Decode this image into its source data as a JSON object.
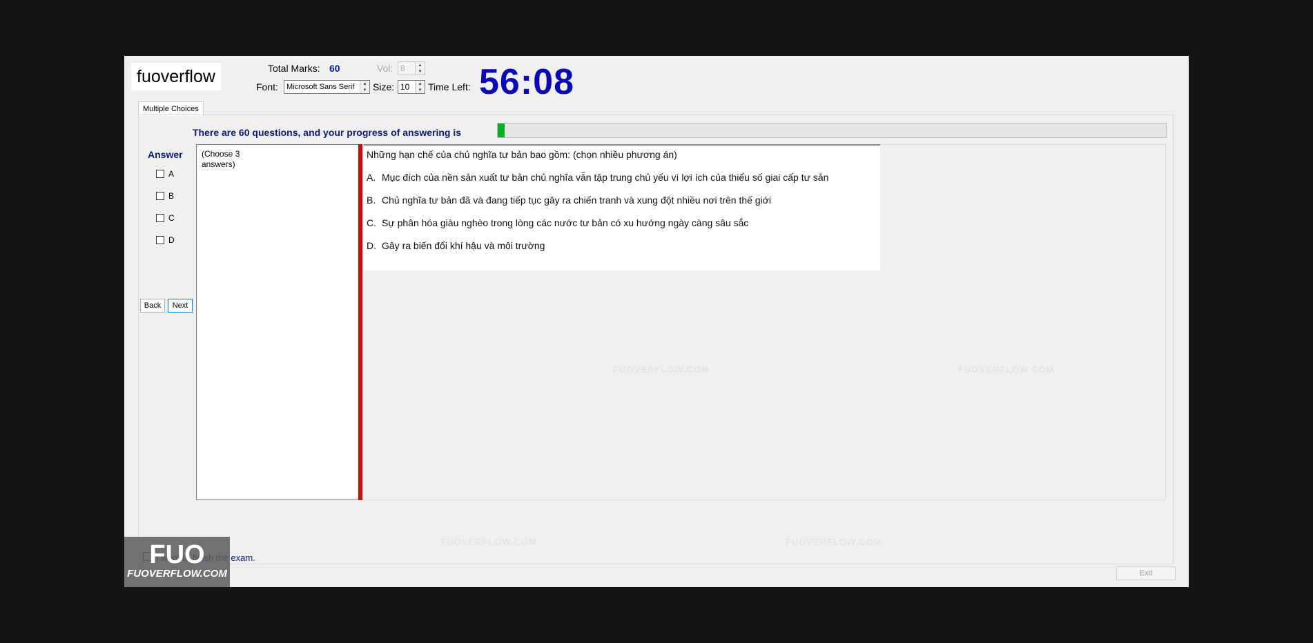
{
  "header": {
    "logo_text": "fuoverflow",
    "total_marks_label": "Total Marks:",
    "total_marks_value": "60",
    "vol_label": "Vol:",
    "vol_value": "8",
    "font_label": "Font:",
    "font_value": "Microsoft Sans Serif",
    "size_label": "Size:",
    "size_value": "10",
    "time_left_label": "Time Left:",
    "time_left_value": "56:08"
  },
  "tabs": [
    {
      "label": "Multiple Choices"
    }
  ],
  "progress": {
    "text": "There are 60 questions, and your progress of answering is",
    "fraction": 0.01
  },
  "answer_panel": {
    "title": "Answer",
    "options": [
      "A",
      "B",
      "C",
      "D"
    ],
    "back_label": "Back",
    "next_label": "Next"
  },
  "choose_hint": "(Choose 3\nanswers)",
  "question": {
    "text": "Những hạn chế của chủ nghĩa tư bản bao gồm: (chọn nhiều phương án)",
    "options": [
      {
        "letter": "A.",
        "text": "Mục đích của nền sản xuất tư bản chủ nghĩa vẫn tập trung chủ yếu vì lợi ích của thiểu số giai cấp tư sản"
      },
      {
        "letter": "B.",
        "text": "Chủ nghĩa tư bản đã và đang tiếp tục gây ra chiến tranh và xung đột nhiều nơi trên thế giới"
      },
      {
        "letter": "C.",
        "text": "Sự phân hóa giàu nghèo trong lòng các nước tư bản có xu hướng ngày càng sâu sắc"
      },
      {
        "letter": "D.",
        "text": "Gây ra biến đổi khí hậu và môi trường"
      }
    ]
  },
  "footer": {
    "finish_label": "I want to finish the exam.",
    "exit_label": "Exit",
    "badge_big": "FUO",
    "badge_small": "FUOVERFLOW.COM"
  },
  "watermark_text": "FUOVERFLOW.COM"
}
